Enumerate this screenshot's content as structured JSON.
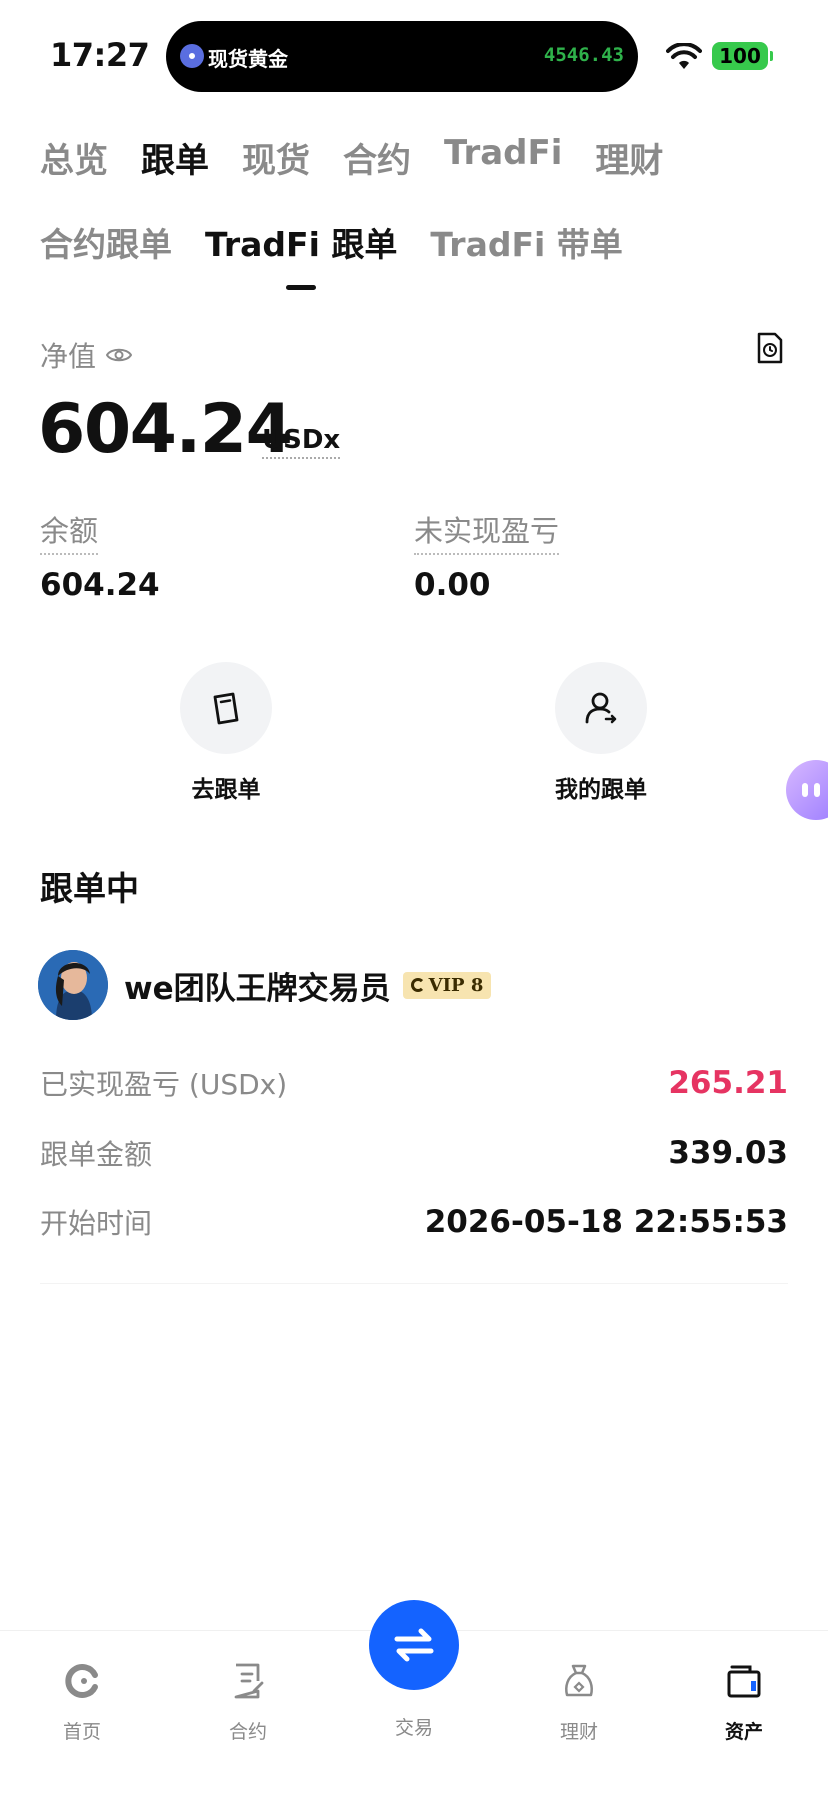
{
  "status_bar": {
    "time": "17:27",
    "island_label": "现货黄金",
    "island_price": "4546.43",
    "battery": "100"
  },
  "top_tabs": [
    {
      "label": "总览",
      "active": false
    },
    {
      "label": "跟单",
      "active": true
    },
    {
      "label": "现货",
      "active": false
    },
    {
      "label": "合约",
      "active": false
    },
    {
      "label": "TradFi",
      "active": false
    },
    {
      "label": "理财",
      "active": false
    }
  ],
  "sub_tabs": [
    {
      "label": "合约跟单",
      "active": false
    },
    {
      "label": "TradFi 跟单",
      "active": true
    },
    {
      "label": "TradFi 带单",
      "active": false
    }
  ],
  "net": {
    "label": "净值",
    "value": "604.24",
    "unit": "USDx"
  },
  "stats": {
    "balance_label": "余额",
    "balance_value": "604.24",
    "upnl_label": "未实现盈亏",
    "upnl_value": "0.00"
  },
  "actions": {
    "go_label": "去跟单",
    "mine_label": "我的跟单"
  },
  "section_title": "跟单中",
  "trader": {
    "name": "we团队王牌交易员",
    "vip": "VIP 8",
    "pnl_label": "已实现盈亏 (USDx)",
    "pnl_value": "265.21",
    "amount_label": "跟单金额",
    "amount_value": "339.03",
    "start_label": "开始时间",
    "start_value": "2026-05-18 22:55:53"
  },
  "bottom_nav": {
    "home": "首页",
    "futures": "合约",
    "trade": "交易",
    "earn": "理财",
    "assets": "资产"
  },
  "colors": {
    "accent": "#1463ff",
    "profit": "#e63462",
    "island_price": "#2fb24b",
    "battery": "#37c94c"
  }
}
